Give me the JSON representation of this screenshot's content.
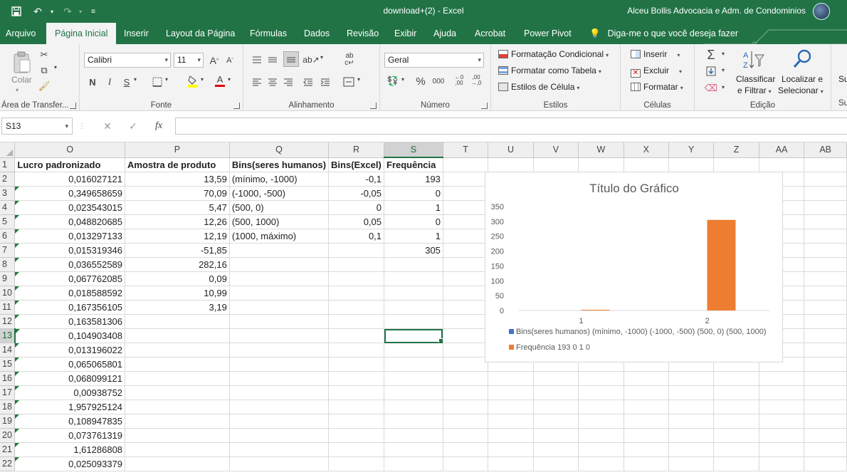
{
  "window": {
    "title": "download+(2)  -  Excel",
    "user": "Alceu Bollis Advocacia e Adm. de Condominios"
  },
  "tabs": [
    "Arquivo",
    "Página Inicial",
    "Inserir",
    "Layout da Página",
    "Fórmulas",
    "Dados",
    "Revisão",
    "Exibir",
    "Ajuda",
    "Acrobat",
    "Power Pivot"
  ],
  "active_tab": "Página Inicial",
  "tell_me": "Diga-me o que você deseja fazer",
  "ribbon": {
    "clipboard": {
      "paste": "Colar",
      "label": "Área de Transfer..."
    },
    "font": {
      "name": "Calibri",
      "size": "11",
      "label": "Fonte",
      "bold": "N",
      "italic": "I",
      "underline": "S",
      "grow": "A",
      "shrink": "A",
      "font_color_letter": "A"
    },
    "alignment": {
      "label": "Alinhamento"
    },
    "number": {
      "format": "Geral",
      "label": "Número",
      "percent": "%",
      "thousands": "000"
    },
    "styles": {
      "conditional": "Formatação Condicional",
      "as_table": "Formatar como Tabela",
      "cell_styles": "Estilos de Célula",
      "label": "Estilos"
    },
    "cells": {
      "insert": "Inserir",
      "delete": "Excluir",
      "format": "Formatar",
      "label": "Células"
    },
    "editing": {
      "sort_line1": "Classificar",
      "sort_line2": "e Filtrar",
      "find_line1": "Localizar e",
      "find_line2": "Selecionar",
      "label": "Edição"
    },
    "extra": "Su",
    "extra2": "Su"
  },
  "formula_bar": {
    "cell_ref": "S13",
    "cancel": "✕",
    "enter": "✓",
    "fx": "fx",
    "value": ""
  },
  "columns": [
    "O",
    "P",
    "Q",
    "R",
    "S",
    "T",
    "U",
    "V",
    "W",
    "X",
    "Y",
    "Z",
    "AA",
    "AB"
  ],
  "rows": [
    {
      "n": "1",
      "O": "Lucro padronizado",
      "P": "Amostra de produto",
      "Q": "Bins(seres humanos)",
      "R": "Bins(Excel)",
      "S": "Frequência"
    },
    {
      "n": "2",
      "O": "0,016027121",
      "P": "13,59",
      "Q": "(mínimo, -1000)",
      "R": "-0,1",
      "S": "193"
    },
    {
      "n": "3",
      "O": "0,349658659",
      "P": "70,09",
      "Q": "(-1000, -500)",
      "R": "-0,05",
      "S": "0"
    },
    {
      "n": "4",
      "O": "0,023543015",
      "P": "5,47",
      "Q": "(500, 0)",
      "R": "0",
      "S": "1"
    },
    {
      "n": "5",
      "O": "0,048820685",
      "P": "12,26",
      "Q": "(500, 1000)",
      "R": "0,05",
      "S": "0"
    },
    {
      "n": "6",
      "O": "0,013297133",
      "P": "12,19",
      "Q": "(1000, máximo)",
      "R": "0,1",
      "S": "1"
    },
    {
      "n": "7",
      "O": "0,015319346",
      "P": "-51,85",
      "Q": "",
      "R": "",
      "S": "305"
    },
    {
      "n": "8",
      "O": "0,036552589",
      "P": "282,16",
      "Q": "",
      "R": "",
      "S": ""
    },
    {
      "n": "9",
      "O": "0,067762085",
      "P": "0,09",
      "Q": "",
      "R": "",
      "S": ""
    },
    {
      "n": "10",
      "O": "0,018588592",
      "P": "10,99",
      "Q": "",
      "R": "",
      "S": ""
    },
    {
      "n": "11",
      "O": "0,167356105",
      "P": "3,19",
      "Q": "",
      "R": "",
      "S": ""
    },
    {
      "n": "12",
      "O": "0,163581306",
      "P": "",
      "Q": "",
      "R": "",
      "S": ""
    },
    {
      "n": "13",
      "O": "0,104903408",
      "P": "",
      "Q": "",
      "R": "",
      "S": ""
    },
    {
      "n": "14",
      "O": "0,013196022",
      "P": "",
      "Q": "",
      "R": "",
      "S": ""
    },
    {
      "n": "15",
      "O": "0,065065801",
      "P": "",
      "Q": "",
      "R": "",
      "S": ""
    },
    {
      "n": "16",
      "O": "0,068099121",
      "P": "",
      "Q": "",
      "R": "",
      "S": ""
    },
    {
      "n": "17",
      "O": "0,00938752",
      "P": "",
      "Q": "",
      "R": "",
      "S": ""
    },
    {
      "n": "18",
      "O": "1,957925124",
      "P": "",
      "Q": "",
      "R": "",
      "S": ""
    },
    {
      "n": "19",
      "O": "0,108947835",
      "P": "",
      "Q": "",
      "R": "",
      "S": ""
    },
    {
      "n": "20",
      "O": "0,073761319",
      "P": "",
      "Q": "",
      "R": "",
      "S": ""
    },
    {
      "n": "21",
      "O": "1,61286808",
      "P": "",
      "Q": "",
      "R": "",
      "S": ""
    },
    {
      "n": "22",
      "O": "0,025093379",
      "P": "",
      "Q": "",
      "R": "",
      "S": ""
    }
  ],
  "selected_cell": {
    "col": "S",
    "row": "13"
  },
  "colors": {
    "excel_green": "#217346",
    "series1": "#4472C4",
    "series2": "#ED7D31"
  },
  "chart_data": {
    "type": "bar",
    "title": "Título do Gráfico",
    "categories": [
      "1",
      "2"
    ],
    "ylim": [
      0,
      350
    ],
    "yticks": [
      "0",
      "50",
      "100",
      "150",
      "200",
      "250",
      "300",
      "350"
    ],
    "series": [
      {
        "name": "Bins(seres humanos) (mínimo, -1000) (-1000, -500) (500, 0) (500, 1000)",
        "values": [
          0,
          0
        ]
      },
      {
        "name": "Frequência 193 0 1 0",
        "values": [
          1,
          305
        ]
      }
    ],
    "legend": "bottom",
    "grid": false
  }
}
